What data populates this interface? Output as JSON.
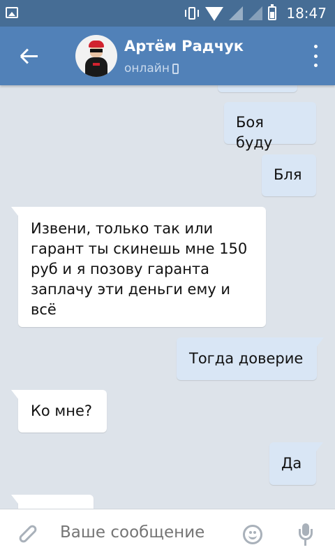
{
  "status_bar": {
    "time": "18:47",
    "icons": [
      "image-icon",
      "vibrate-icon",
      "wifi-icon",
      "signal-icon",
      "signal-icon",
      "battery-icon"
    ]
  },
  "header": {
    "contact_name": "Артём Радчук",
    "status": "онлайн",
    "colors": {
      "bar": "#5181b8",
      "status_bar": "#466d95"
    }
  },
  "messages": [
    {
      "direction": "out",
      "text": ""
    },
    {
      "direction": "out",
      "text": "Боя буду"
    },
    {
      "direction": "out",
      "text": "Бля"
    },
    {
      "direction": "in",
      "lines": [
        "Извени, только так или",
        "гарант ты скинешь мне 150",
        "руб и я позову гаранта",
        "заплачу эти деньги ему и",
        "всё"
      ]
    },
    {
      "direction": "out",
      "text": "Тогда доверие"
    },
    {
      "direction": "in",
      "text": "Ко мне?"
    },
    {
      "direction": "out",
      "text": "Да"
    },
    {
      "direction": "in",
      "text": ""
    }
  ],
  "composer": {
    "placeholder": "Ваше сообщение"
  },
  "colors": {
    "background": "#dde3ea",
    "outgoing_bubble": "#d9e6f5",
    "incoming_bubble": "#ffffff"
  }
}
